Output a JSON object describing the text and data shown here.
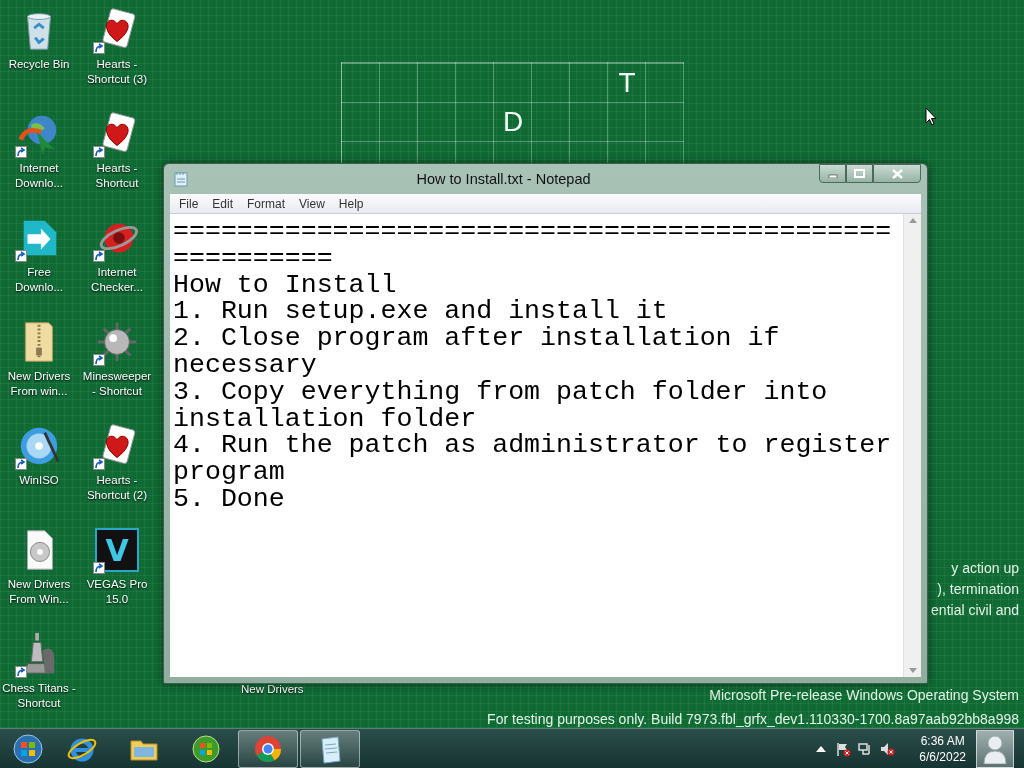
{
  "desktop": {
    "icons": [
      {
        "label": "Recycle Bin",
        "kind": "recycle",
        "shortcut": false
      },
      {
        "label": "Internet\nDownlo...",
        "kind": "download-globe",
        "shortcut": true
      },
      {
        "label": "Free\nDownlo...",
        "kind": "free-download",
        "shortcut": true
      },
      {
        "label": "New Drivers\nFrom win...",
        "kind": "zip-folder",
        "shortcut": false
      },
      {
        "label": "WinISO",
        "kind": "disc-app",
        "shortcut": true
      },
      {
        "label": "New Drivers\nFrom Win...",
        "kind": "disc-file",
        "shortcut": false
      },
      {
        "label": "Chess Titans -\nShortcut",
        "kind": "chess",
        "shortcut": true
      },
      {
        "label": "Hearts -\nShortcut (3)",
        "kind": "hearts",
        "shortcut": true
      },
      {
        "label": "Hearts -\nShortcut",
        "kind": "hearts",
        "shortcut": true
      },
      {
        "label": "Internet\nChecker...",
        "kind": "checker",
        "shortcut": true
      },
      {
        "label": "Minesweeper\n- Shortcut",
        "kind": "mine",
        "shortcut": true
      },
      {
        "label": "Hearts -\nShortcut (2)",
        "kind": "hearts",
        "shortcut": true
      },
      {
        "label": "VEGAS Pro\n15.0",
        "kind": "vegas",
        "shortcut": true,
        "badge": "V"
      }
    ],
    "hidden_icon_label": "New Drivers",
    "wallpaper_grid": [
      "       T ",
      "    D    "
    ],
    "background_text": [
      "y action up",
      "), termination",
      "ential civil and"
    ],
    "watermark": [
      "Microsoft Pre-release Windows Operating System",
      "For testing purposes only. Build 7973.fbl_grfx_dev1.110330-1700.8a97aab92bb8a998"
    ]
  },
  "notepad": {
    "title": "How to Install.txt - Notepad",
    "menu": [
      "File",
      "Edit",
      "Format",
      "View",
      "Help"
    ],
    "lines": [
      "=======================================================",
      "How to Install",
      "1. Run setup.exe and install it",
      "2. Close program after installation if necessary",
      "3. Copy everything from patch folder into installation folder",
      "4. Run the patch as administrator to register program",
      "5. Done"
    ]
  },
  "taskbar": {
    "apps": [
      {
        "kind": "start",
        "running": false
      },
      {
        "kind": "ie",
        "running": false
      },
      {
        "kind": "explorer",
        "running": false
      },
      {
        "kind": "media",
        "running": false
      },
      {
        "kind": "chrome",
        "running": true
      },
      {
        "kind": "notepad",
        "running": true
      }
    ],
    "tray": [
      {
        "kind": "show-hidden"
      },
      {
        "kind": "action-center"
      },
      {
        "kind": "network"
      },
      {
        "kind": "volume"
      }
    ],
    "clock": {
      "time": "6:36 AM",
      "date": "6/6/2022"
    }
  }
}
